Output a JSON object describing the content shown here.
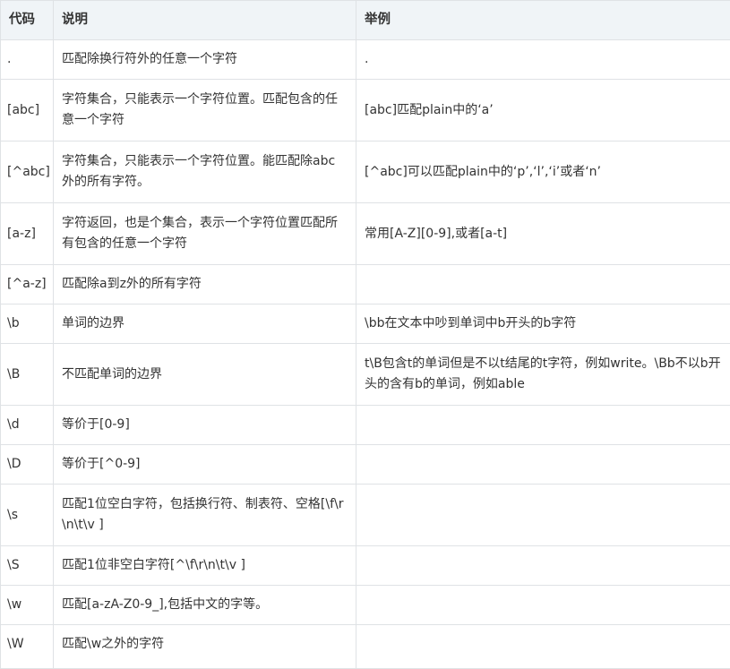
{
  "headers": [
    "代码",
    "说明",
    "举例"
  ],
  "rows": [
    {
      "code": ".",
      "desc": "匹配除换行符外的任意一个字符",
      "example": "."
    },
    {
      "code": "[abc]",
      "desc": "字符集合，只能表示一个字符位置。匹配包含的任意一个字符",
      "example": "[abc]匹配plain中的‘a’"
    },
    {
      "code": "[^abc]",
      "desc": "字符集合，只能表示一个字符位置。能匹配除abc外的所有字符。",
      "example": "[^abc]可以匹配plain中的‘p’,‘l’,‘i’或者‘n’"
    },
    {
      "code": "[a-z]",
      "desc": "字符返回，也是个集合，表示一个字符位置匹配所有包含的任意一个字符",
      "example": "常用[A-Z][0-9],或者[a-t]"
    },
    {
      "code": "[^a-z]",
      "desc": "匹配除a到z外的所有字符",
      "example": ""
    },
    {
      "code": "\\b",
      "desc": "单词的边界",
      "example": "\\bb在文本中吵到单词中b开头的b字符"
    },
    {
      "code": "\\B",
      "desc": "不匹配单词的边界",
      "example": "t\\B包含t的单词但是不以t结尾的t字符，例如write。\\Bb不以b开头的含有b的单词，例如able"
    },
    {
      "code": "\\d",
      "desc": "等价于[0-9]",
      "example": ""
    },
    {
      "code": "\\D",
      "desc": "等价于[^0-9]",
      "example": ""
    },
    {
      "code": "\\s",
      "desc": "匹配1位空白字符，包括换行符、制表符、空格[\\f\\r\\n\\t\\v ]",
      "example": ""
    },
    {
      "code": "\\S",
      "desc": "匹配1位非空白字符[^\\f\\r\\n\\t\\v ]",
      "example": ""
    },
    {
      "code": "\\w",
      "desc": "匹配[a-zA-Z0-9_],包括中文的字等。",
      "example": ""
    },
    {
      "code": "\\W",
      "desc": "匹配\\w之外的字符",
      "example": ""
    }
  ]
}
